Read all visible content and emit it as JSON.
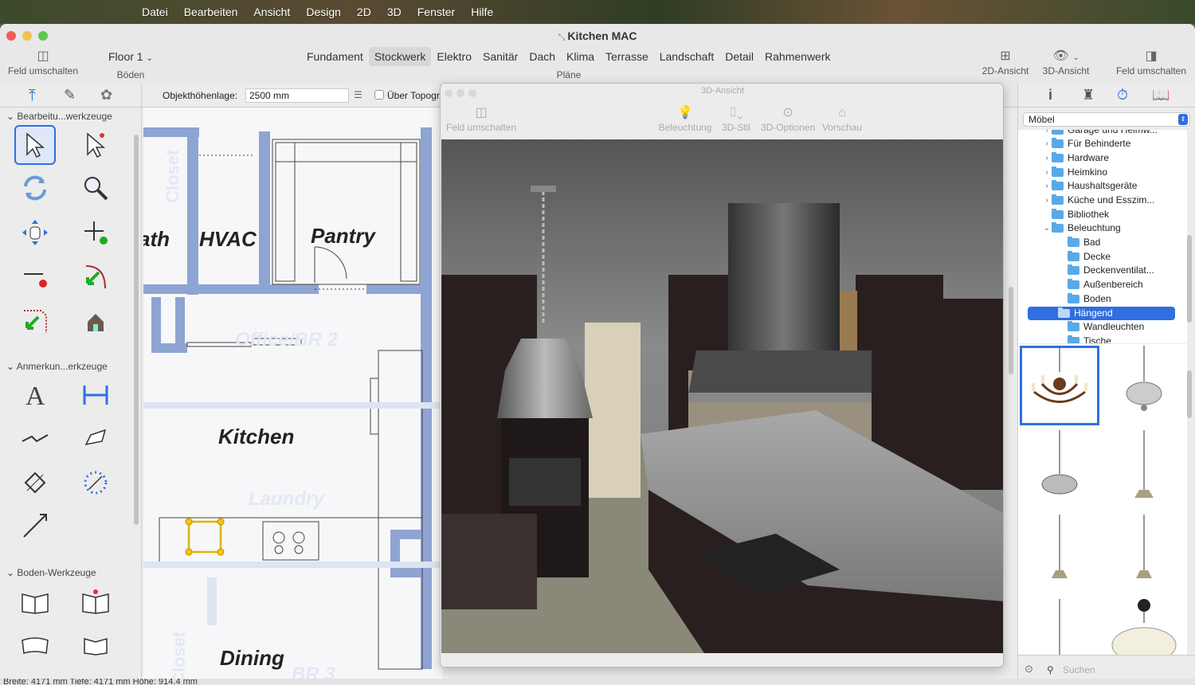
{
  "menubar": {
    "items": [
      "Datei",
      "Bearbeiten",
      "Ansicht",
      "Design",
      "2D",
      "3D",
      "Fenster",
      "Hilfe"
    ]
  },
  "window": {
    "title": "Kitchen MAC",
    "left_toggle_label": "Feld umschalten",
    "floor_select": "Floor 1",
    "floors_label": "Böden",
    "plans_label": "Pläne",
    "plan_tabs": [
      "Fundament",
      "Stockwerk",
      "Elektro",
      "Sanitär",
      "Dach",
      "Klima",
      "Terrasse",
      "Landschaft",
      "Detail",
      "Rahmenwerk"
    ],
    "selected_plan_tab": "Stockwerk",
    "view2d_label": "2D-Ansicht",
    "view3d_label": "3D-Ansicht",
    "right_toggle_label": "Feld umschalten"
  },
  "properties": {
    "height_label": "Objekthöhenlage:",
    "height_value": "2500 mm",
    "topo_label": "Über Topogr"
  },
  "tools": {
    "section1": "Bearbeitu...werkzeuge",
    "section2": "Anmerkun...erkzeuge",
    "section3": "Boden-Werkzeuge"
  },
  "floorplan": {
    "rooms": [
      "ath",
      "HVAC",
      "Pantry",
      "Office/BR 2",
      "Kitchen",
      "Laundry",
      "Dining",
      "BR 3",
      "Closet",
      "Closet"
    ]
  },
  "view3d": {
    "title": "3D-Ansicht",
    "toggle_label": "Feld umschalten",
    "buttons": [
      "Beleuchtung",
      "3D-Stil",
      "3D-Optionen",
      "Vorschau"
    ]
  },
  "library": {
    "selected": "Möbel",
    "tree": [
      {
        "label": "Garage und Heimw...",
        "level": 0,
        "expand": ">",
        "partial": true
      },
      {
        "label": "Für Behinderte",
        "level": 0,
        "expand": ">"
      },
      {
        "label": "Hardware",
        "level": 0,
        "expand": ">"
      },
      {
        "label": "Heimkino",
        "level": 0,
        "expand": ">"
      },
      {
        "label": "Haushaltsgeräte",
        "level": 0,
        "expand": ">"
      },
      {
        "label": "Küche und Esszim...",
        "level": 0,
        "expand": ">"
      },
      {
        "label": "Bibliothek",
        "level": 0,
        "expand": ""
      },
      {
        "label": "Beleuchtung",
        "level": 0,
        "expand": "v"
      },
      {
        "label": "Bad",
        "level": 1,
        "expand": ""
      },
      {
        "label": "Decke",
        "level": 1,
        "expand": ""
      },
      {
        "label": "Deckenventilat...",
        "level": 1,
        "expand": ""
      },
      {
        "label": "Außenbereich",
        "level": 1,
        "expand": ""
      },
      {
        "label": "Boden",
        "level": 1,
        "expand": ""
      },
      {
        "label": "Hängend",
        "level": 1,
        "expand": "",
        "selected": true
      },
      {
        "label": "Wandleuchten",
        "level": 1,
        "expand": ""
      },
      {
        "label": "Tische",
        "level": 1,
        "expand": ""
      }
    ],
    "search_placeholder": "Suchen"
  },
  "status": {
    "text": "Breite: 4171 mm   Tiefe: 4171 mm   Höhe: 914.4 mm"
  },
  "colors": {
    "accent": "#2f6fe0",
    "wall": "#8ea4d2",
    "folder": "#5aa9e6"
  }
}
